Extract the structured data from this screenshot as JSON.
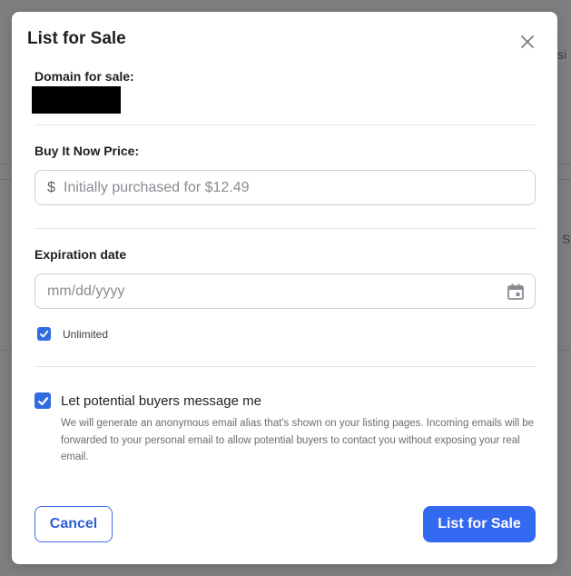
{
  "background": {
    "partial_text_top": "si",
    "partial_text_mid": "S"
  },
  "modal": {
    "title": "List for Sale",
    "close_icon": "close-icon"
  },
  "domain": {
    "label": "Domain for sale:",
    "value_redacted": true
  },
  "price": {
    "label": "Buy It Now Price:",
    "currency_symbol": "$",
    "placeholder": "Initially purchased for $12.49",
    "value": ""
  },
  "expiration": {
    "label": "Expiration date",
    "placeholder": "mm/dd/yyyy",
    "value": "",
    "calendar_icon": "calendar-icon",
    "unlimited_label": "Unlimited",
    "unlimited_checked": true
  },
  "messaging": {
    "checked": true,
    "title": "Let potential buyers message me",
    "description": "We will generate an anonymous email alias that's shown on your listing pages. Incoming emails will be forwarded to your personal email to allow potential buyers to contact you without exposing your real email."
  },
  "actions": {
    "cancel_label": "Cancel",
    "submit_label": "List for Sale"
  },
  "colors": {
    "accent": "#3368f0",
    "overlay": "#7f7f80"
  }
}
